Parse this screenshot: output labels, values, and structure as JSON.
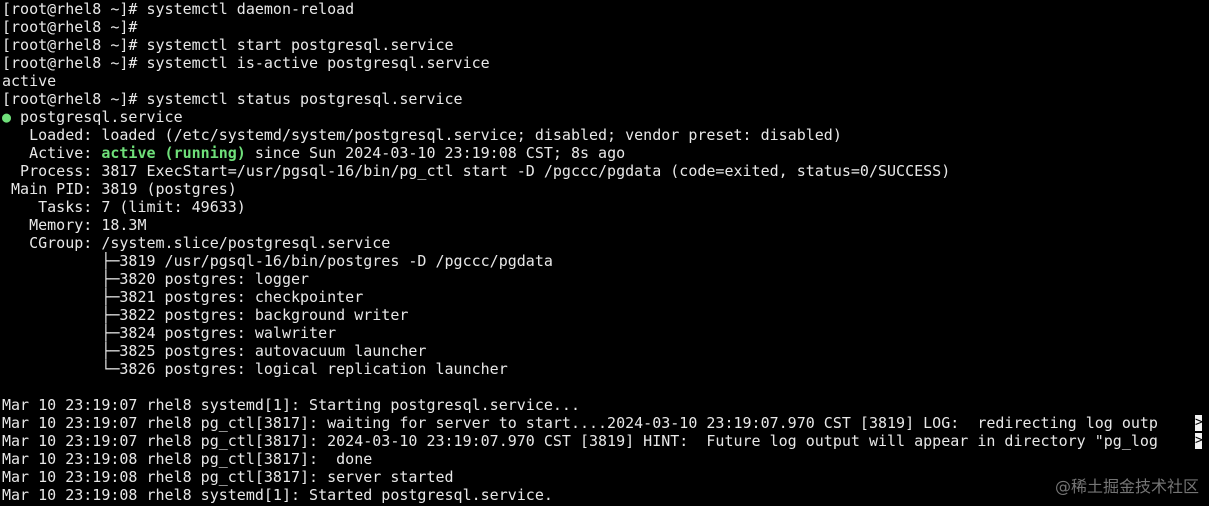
{
  "terminal": {
    "lines": [
      "[root@rhel8 ~]# systemctl daemon-reload",
      "[root@rhel8 ~]#",
      "[root@rhel8 ~]# systemctl start postgresql.service",
      "[root@rhel8 ~]# systemctl is-active postgresql.service",
      "active",
      "[root@rhel8 ~]# systemctl status postgresql.service"
    ],
    "status": {
      "bullet": "●",
      "unit": " postgresql.service",
      "loaded": "   Loaded: loaded (/etc/systemd/system/postgresql.service; disabled; vendor preset: disabled)",
      "active_label": "   Active: ",
      "active_state": "active (running)",
      "active_rest": " since Sun 2024-03-10 23:19:08 CST; 8s ago",
      "details": [
        "  Process: 3817 ExecStart=/usr/pgsql-16/bin/pg_ctl start -D /pgccc/pgdata (code=exited, status=0/SUCCESS)",
        " Main PID: 3819 (postgres)",
        "    Tasks: 7 (limit: 49633)",
        "   Memory: 18.3M",
        "   CGroup: /system.slice/postgresql.service",
        "           ├─3819 /usr/pgsql-16/bin/postgres -D /pgccc/pgdata",
        "           ├─3820 postgres: logger",
        "           ├─3821 postgres: checkpointer",
        "           ├─3822 postgres: background writer",
        "           ├─3824 postgres: walwriter",
        "           ├─3825 postgres: autovacuum launcher",
        "           └─3826 postgres: logical replication launcher"
      ]
    },
    "logs": [
      "Mar 10 23:19:07 rhel8 systemd[1]: Starting postgresql.service...",
      "Mar 10 23:19:07 rhel8 pg_ctl[3817]: waiting for server to start....2024-03-10 23:19:07.970 CST [3819] LOG:  redirecting log outp",
      "Mar 10 23:19:07 rhel8 pg_ctl[3817]: 2024-03-10 23:19:07.970 CST [3819] HINT:  Future log output will appear in directory \"pg_log",
      "Mar 10 23:19:08 rhel8 pg_ctl[3817]:  done",
      "Mar 10 23:19:08 rhel8 pg_ctl[3817]: server started",
      "Mar 10 23:19:08 rhel8 systemd[1]: Started postgresql.service."
    ],
    "truncation_marker": ">"
  },
  "watermark": "@稀土掘金技术社区",
  "colors": {
    "background": "#000000",
    "foreground": "#e8e8e8",
    "green": "#6fe07a"
  }
}
